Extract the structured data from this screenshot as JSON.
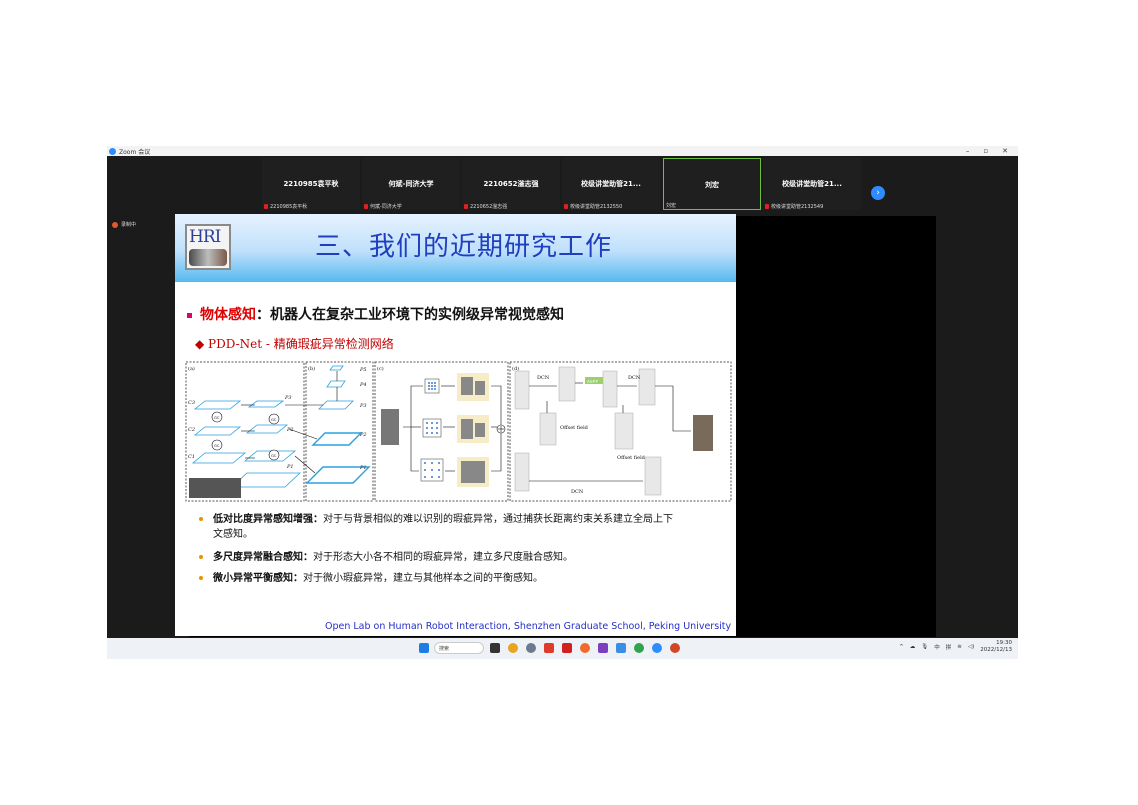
{
  "window": {
    "app_title": "Zoom 会议",
    "controls": [
      "–",
      "▫",
      "✕"
    ]
  },
  "gallery": {
    "tiles": [
      {
        "name": "2210985袁平秋",
        "footer": "2210985袁平秋"
      },
      {
        "name": "何斌-同济大学",
        "footer": "何斌-同济大学"
      },
      {
        "name": "2210652滏志强",
        "footer": "2210652滏志强"
      },
      {
        "name": "校级讲堂助管21...",
        "footer": "校级讲堂助管2132550"
      },
      {
        "name": "刘宏",
        "footer": "刘宏"
      },
      {
        "name": "校级讲堂助管21...",
        "footer": "校级讲堂助管2132549"
      }
    ],
    "next_icon": "›"
  },
  "recording": {
    "label": "录制中"
  },
  "slide": {
    "logo_text": "HRI",
    "title": "三、我们的近期研究工作",
    "bullet_red": "物体感知",
    "bullet_rest": "：机器人在复杂工业环境下的实例级异常视觉感知",
    "subheading": "◆ PDD-Net - 精确瑕疵异常检测网络",
    "figure_labels": {
      "a": "(a)",
      "b": "(b)",
      "c": "(c)",
      "d": "(d)",
      "c3": "C3",
      "c2": "C2",
      "c1": "C1",
      "p3": "P3",
      "p2": "P2",
      "p1": "P1",
      "pb5": "P5",
      "pb4": "P4",
      "pb3": "P3",
      "pb2": "P2",
      "pb1": "P1",
      "dcn": "DCN",
      "aspp": "ASPP",
      "offset": "Offset field",
      "gc": "GC"
    },
    "points": [
      {
        "bold": "低对比度异常感知增强：",
        "text": "对于与背景相似的难以识别的瑕疵异常，通过捕获长距离约束关系建立全局上下",
        "text2": "文感知。"
      },
      {
        "bold": "多尺度异常融合感知：",
        "text": "对于形态大小各不相同的瑕疵异常，建立多尺度融合感知。"
      },
      {
        "bold": "微小异常平衡感知：",
        "text": "对于微小瑕疵异常，建立与其他样本之间的平衡感知。"
      }
    ],
    "footer": "Open Lab on Human Robot Interaction, Shenzhen Graduate School, Peking University"
  },
  "taskbar": {
    "search_label": "搜索",
    "tray": [
      "^",
      "中",
      "拼"
    ],
    "time": "19:30",
    "date": "2022/12/13"
  }
}
